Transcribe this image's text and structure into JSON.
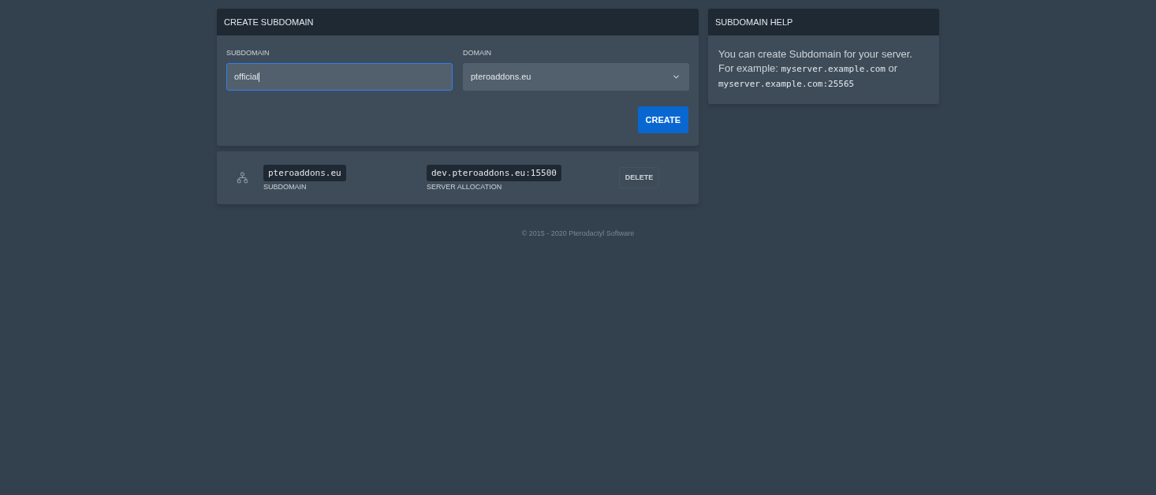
{
  "create_panel": {
    "title": "CREATE SUBDOMAIN",
    "fields": [
      {
        "kind": "input",
        "label": "SUBDOMAIN",
        "value": "official",
        "focused": true
      },
      {
        "kind": "select",
        "label": "DOMAIN",
        "value": "pteroaddons.eu",
        "focused": false
      }
    ],
    "button": "CREATE"
  },
  "subdomains": [
    {
      "subdomain": "pteroaddons.eu",
      "subdomain_label": "SUBDOMAIN",
      "allocation": "dev.pteroaddons.eu:15500",
      "allocation_label": "SERVER ALLOCATION",
      "action": "DELETE"
    }
  ],
  "help_panel": {
    "title": "SUBDOMAIN HELP",
    "text": [
      {
        "kind": "text",
        "text": "You can create Subdomain for your server. For example: "
      },
      {
        "kind": "code",
        "text": "myserver.example.com"
      },
      {
        "kind": "text",
        "text": " or "
      },
      {
        "kind": "code",
        "text": "myserver.example.com:25565"
      }
    ]
  },
  "footer": "© 2015 - 2020 Pterodactyl Software"
}
